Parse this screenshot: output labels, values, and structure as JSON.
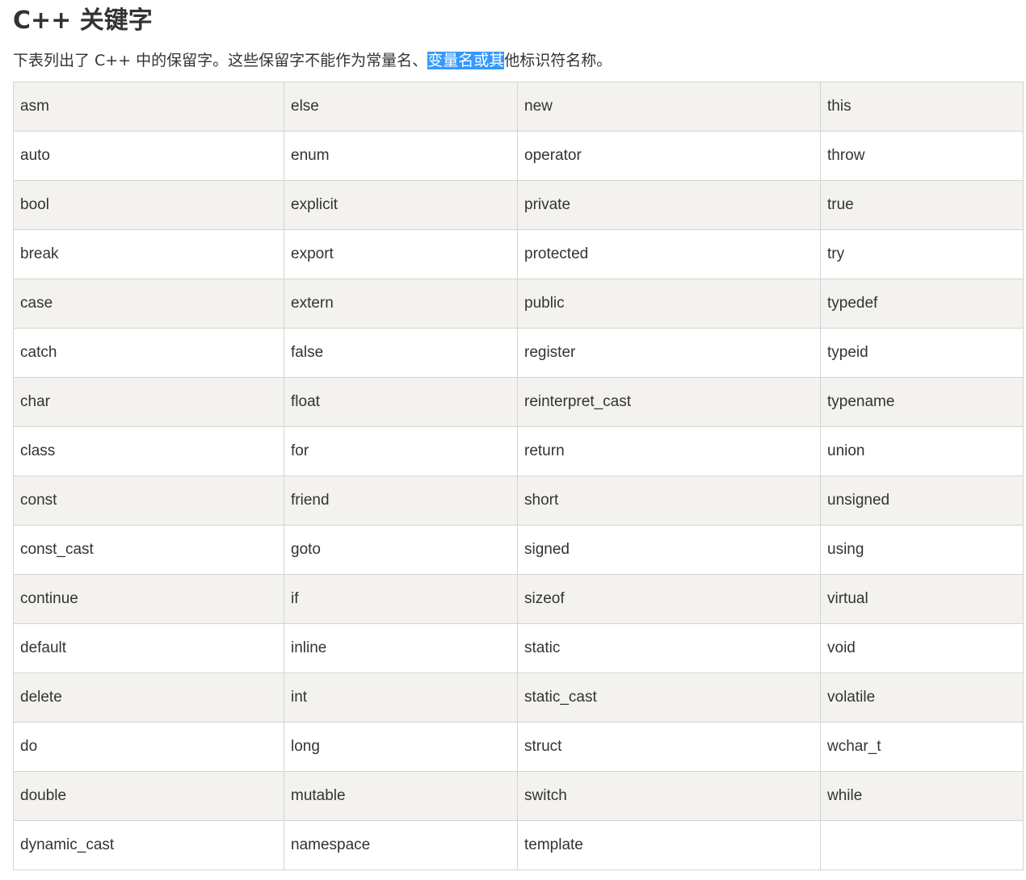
{
  "page": {
    "title": "C++ 关键字",
    "intro": {
      "before": "下表列出了 C++ 中的保留字。这些保留字不能作为常量名、",
      "selected": "变量名或其",
      "after": "他标识符名称。"
    }
  },
  "colors": {
    "row_shaded": "#f3f2ef",
    "row_plain": "#ffffff",
    "border": "#d4d4d4",
    "selection": "#3399ff",
    "text": "#333333"
  },
  "keywords_table": {
    "rows": [
      [
        "asm",
        "else",
        "new",
        "this"
      ],
      [
        "auto",
        "enum",
        "operator",
        "throw"
      ],
      [
        "bool",
        "explicit",
        "private",
        "true"
      ],
      [
        "break",
        "export",
        "protected",
        "try"
      ],
      [
        "case",
        "extern",
        "public",
        "typedef"
      ],
      [
        "catch",
        "false",
        "register",
        "typeid"
      ],
      [
        "char",
        "float",
        "reinterpret_cast",
        "typename"
      ],
      [
        "class",
        "for",
        "return",
        "union"
      ],
      [
        "const",
        "friend",
        "short",
        "unsigned"
      ],
      [
        "const_cast",
        "goto",
        "signed",
        "using"
      ],
      [
        "continue",
        "if",
        "sizeof",
        "virtual"
      ],
      [
        "default",
        "inline",
        "static",
        "void"
      ],
      [
        "delete",
        "int",
        "static_cast",
        "volatile"
      ],
      [
        "do",
        "long",
        "struct",
        "wchar_t"
      ],
      [
        "double",
        "mutable",
        "switch",
        "while"
      ],
      [
        "dynamic_cast",
        "namespace",
        "template",
        ""
      ]
    ]
  }
}
